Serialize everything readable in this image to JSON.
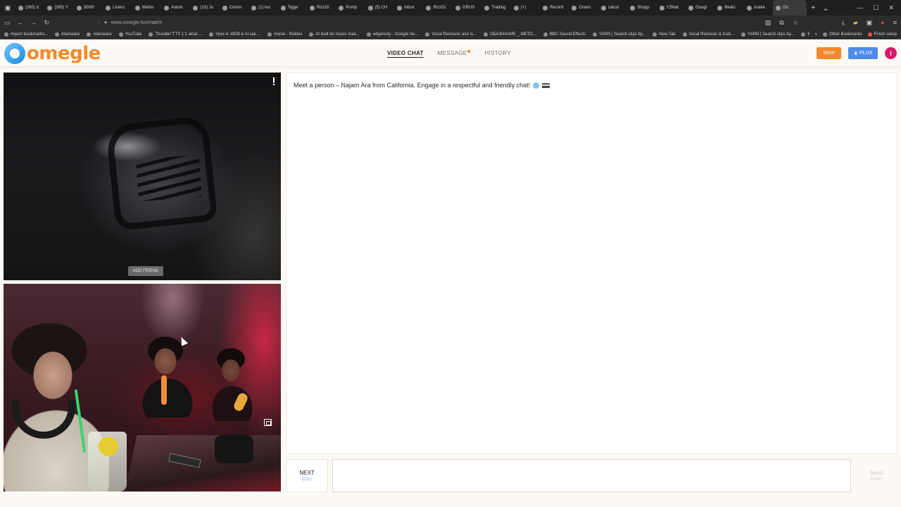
{
  "browser": {
    "tabs": [
      "(265) d",
      "(265) Y",
      "3000/",
      "Licenc",
      "Websi",
      "Axiom",
      "(13) Jo",
      "Comm",
      "(1) koi",
      "Tigge",
      "RizzGi",
      "Pump",
      "(5) CH",
      "Inbox",
      "RizzGi",
      "GRUS",
      "Trading",
      "(+)",
      "Record",
      "Green",
      "calcul",
      "Shopp",
      "Y2Mat",
      "Googl",
      "Beats",
      "snake",
      "On"
    ],
    "url": "www.omegle.fun/match",
    "bookmarks": [
      "Import bookmarks...",
      "Alienware",
      "Alienware",
      "YouTube",
      "Thunder\"TTS 1:1 what ...",
      "Урок 4: WEB в AI как ...",
      "Home - Roblox",
      "AI built for music mak...",
      "edgenuity - Google Se...",
      "Vocal Remover and Is...",
      "ОБАЗНАНИЕ _ МЕТО...",
      "BBC Sound Effects",
      "YARN | Search clips by...",
      "New Tab",
      "Vocal Remover & Instr...",
      "YARN | Search clips by...",
      "BBC Sound Effects"
    ],
    "bookmarks_right": [
      "Other Bookmarks",
      "Finish setup"
    ]
  },
  "site": {
    "logo_text": "omegle",
    "nav": {
      "video_chat": "VIDEO CHAT",
      "message": "MESSAGE",
      "history": "HISTORY"
    },
    "store_label": "Store",
    "plus_label": "PLUS",
    "avatar_letter": "i"
  },
  "stranger_video": {
    "report_glyph": "!",
    "add_friend_label": "ADD FRIEND"
  },
  "chat": {
    "system_message": "Meet a person – Najam Ara from California. Engage in a respectful and friendly chat!"
  },
  "controls": {
    "next_label": "NEXT",
    "next_hint": "(Esc)",
    "send_label": "Send",
    "send_hint": "(Enter)",
    "input_placeholder": ""
  },
  "colors": {
    "accent_orange": "#f28a2c",
    "plus_blue": "#4d8ce8",
    "avatar_pink": "#d71967"
  }
}
